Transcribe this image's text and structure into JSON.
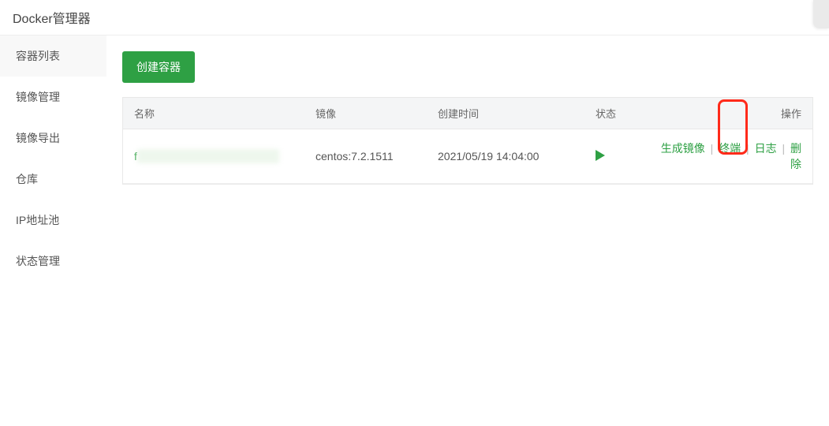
{
  "header": {
    "title": "Docker管理器"
  },
  "sidebar": {
    "items": [
      {
        "label": "容器列表"
      },
      {
        "label": "镜像管理"
      },
      {
        "label": "镜像导出"
      },
      {
        "label": "仓库"
      },
      {
        "label": "IP地址池"
      },
      {
        "label": "状态管理"
      }
    ]
  },
  "main": {
    "create_button": "创建容器",
    "columns": {
      "name": "名称",
      "image": "镜像",
      "created": "创建时间",
      "status": "状态",
      "ops": "操作"
    },
    "rows": [
      {
        "name_prefix": "f",
        "image": "centos:7.2.1511",
        "created": "2021/05/19 14:04:00",
        "status_icon": "play",
        "actions": {
          "gen_image": "生成镜像",
          "terminal": "终端",
          "logs": "日志",
          "delete": "删除"
        }
      }
    ],
    "sep": "|"
  }
}
